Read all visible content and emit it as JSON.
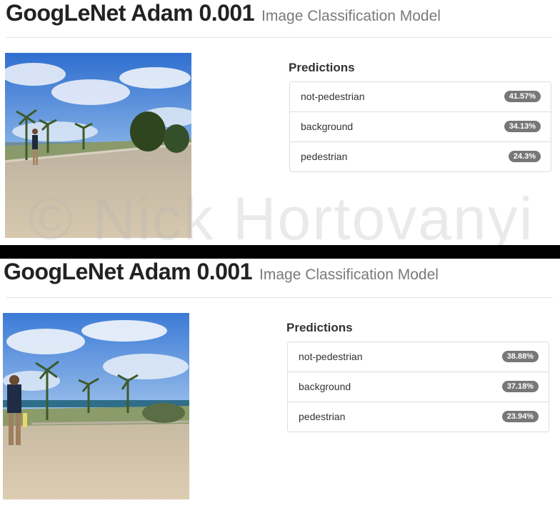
{
  "panels": [
    {
      "title": "GoogLeNet Adam 0.001",
      "subtitle": "Image Classification Model",
      "predictions_heading": "Predictions",
      "predictions": [
        {
          "label": "not-pedestrian",
          "value": "41.57%"
        },
        {
          "label": "background",
          "value": "34.13%"
        },
        {
          "label": "pedestrian",
          "value": "24.3%"
        }
      ],
      "watermark": "© Nick Hortovanyi"
    },
    {
      "title": "GoogLeNet Adam 0.001",
      "subtitle": "Image Classification Model",
      "predictions_heading": "Predictions",
      "predictions": [
        {
          "label": "not-pedestrian",
          "value": "38.88%"
        },
        {
          "label": "background",
          "value": "37.18%"
        },
        {
          "label": "pedestrian",
          "value": "23.94%"
        }
      ]
    }
  ],
  "colors": {
    "badge": "#777777",
    "sky": "#4a86d6",
    "sand": "#cfc1a6"
  }
}
